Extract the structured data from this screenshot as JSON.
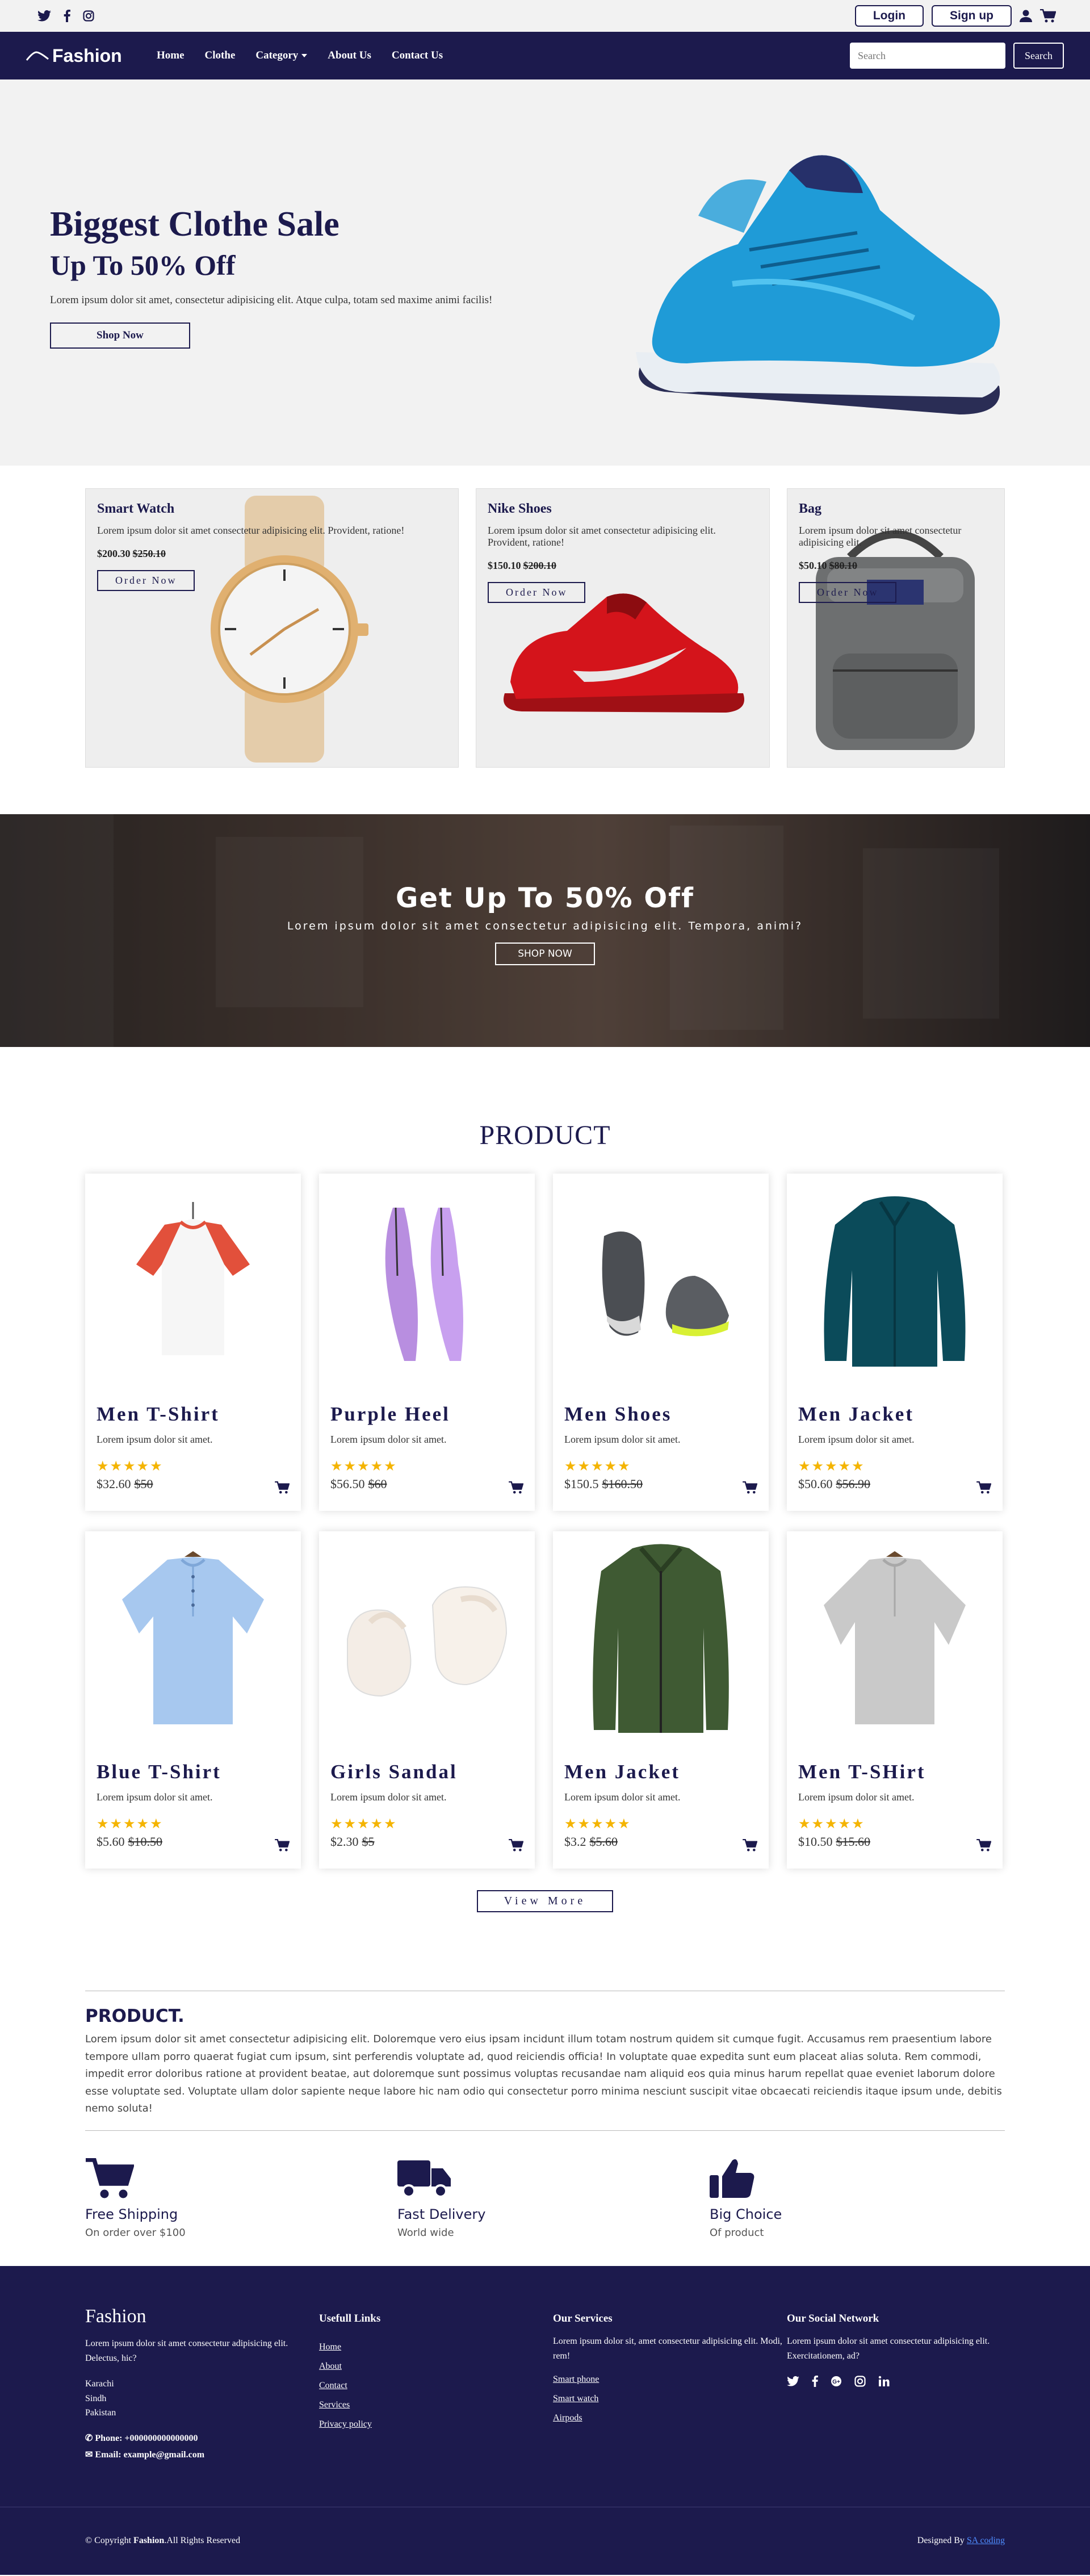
{
  "topbar": {
    "login": "Login",
    "signup": "Sign up"
  },
  "navbar": {
    "brand": "Fashion",
    "links": [
      "Home",
      "Clothe",
      "Category",
      "About Us",
      "Contact Us"
    ],
    "search_placeholder": "Search",
    "search_button": "Search"
  },
  "hero": {
    "title": "Biggest Clothe Sale",
    "subtitle": "Up To 50% Off",
    "text": "Lorem ipsum dolor sit amet, consectetur adipisicing elit. Atque culpa, totam sed maxime animi facilis!",
    "button": "Shop Now"
  },
  "offers": [
    {
      "title": "Smart Watch",
      "text": "Lorem ipsum dolor sit amet consectetur adipisicing elit. Provident, ratione!",
      "price": "$200.30",
      "old": "$250.10",
      "button": "Order Now"
    },
    {
      "title": "Nike Shoes",
      "text": "Lorem ipsum dolor sit amet consectetur adipisicing elit. Provident, ratione!",
      "price": "$150.10",
      "old": "$200.10",
      "button": "Order Now"
    },
    {
      "title": "Bag",
      "text": "Lorem ipsum dolor sit amet consectetur adipisicing elit.",
      "price": "$50.10",
      "old": "$80.10",
      "button": "Order Now"
    }
  ],
  "promo": {
    "title": "Get Up To 50% Off",
    "text": "Lorem ipsum dolor sit amet consectetur adipisicing elit. Tempora, animi?",
    "button": "SHOP NOW"
  },
  "products": {
    "title": "PRODUCT",
    "items": [
      {
        "name": "Men T-Shirt",
        "desc": "Lorem ipsum dolor sit amet.",
        "price": "$32.60",
        "old": "$50"
      },
      {
        "name": "Purple Heel",
        "desc": "Lorem ipsum dolor sit amet.",
        "price": "$56.50",
        "old": "$60"
      },
      {
        "name": "Men Shoes",
        "desc": "Lorem ipsum dolor sit amet.",
        "price": "$150.5",
        "old": "$160.50"
      },
      {
        "name": "Men Jacket",
        "desc": "Lorem ipsum dolor sit amet.",
        "price": "$50.60",
        "old": "$56.90"
      },
      {
        "name": "Blue T-Shirt",
        "desc": "Lorem ipsum dolor sit amet.",
        "price": "$5.60",
        "old": "$10.50"
      },
      {
        "name": "Girls Sandal",
        "desc": "Lorem ipsum dolor sit amet.",
        "price": "$2.30",
        "old": "$5"
      },
      {
        "name": "Men Jacket",
        "desc": "Lorem ipsum dolor sit amet.",
        "price": "$3.2",
        "old": "$5.60"
      },
      {
        "name": "Men T-SHirt",
        "desc": "Lorem ipsum dolor sit amet.",
        "price": "$10.50",
        "old": "$15.60"
      }
    ],
    "stars": "★★★★★",
    "view_more": "View More"
  },
  "about": {
    "title": "PRODUCT.",
    "text": "Lorem ipsum dolor sit amet consectetur adipisicing elit. Doloremque vero eius ipsam incidunt illum totam nostrum quidem sit cumque fugit. Accusamus rem praesentium labore tempore ullam porro quaerat fugiat cum ipsum, sint perferendis voluptate ad, quod reiciendis officia! In voluptate quae expedita sunt eum placeat alias soluta. Rem commodi, impedit error doloribus ratione at provident beatae, aut doloremque sunt possimus voluptas recusandae nam aliquid eos quia minus harum repellat quae eveniet laborum dolore esse voluptate sed. Voluptate ullam dolor sapiente neque labore hic nam odio qui consectetur porro minima nesciunt suscipit vitae obcaecati reiciendis itaque ipsum unde, debitis nemo soluta!"
  },
  "features": [
    {
      "title": "Free Shipping",
      "text": "On order over $100",
      "icon": "cart-icon"
    },
    {
      "title": "Fast Delivery",
      "text": "World wide",
      "icon": "truck-icon"
    },
    {
      "title": "Big Choice",
      "text": "Of product",
      "icon": "thumbs-up-icon"
    }
  ],
  "footer": {
    "logo": "Fashion",
    "about": "Lorem ipsum dolor sit amet consectetur adipisicing elit. Delectus, hic?",
    "address": [
      "Karachi",
      "Sindh",
      "Pakistan"
    ],
    "phone": "Phone: +000000000000000",
    "email": "Email: example@gmail.com",
    "links_title": "Usefull Links",
    "links": [
      "Home",
      "About",
      "Contact",
      "Services",
      "Privacy policy"
    ],
    "services_title": "Our Services",
    "services_text": "Lorem ipsum dolor sit, amet consectetur adipisicing elit. Modi, rem!",
    "services": [
      "Smart phone",
      "Smart watch",
      "Airpods"
    ],
    "social_title": "Our Social Network",
    "social_text": "Lorem ipsum dolor sit amet consectetur adipisicing elit. Exercitationem, ad?",
    "copyright_prefix": "© Copyright ",
    "copyright_brand": "Fashion",
    "copyright_suffix": ".All Rights Reserved",
    "designed_by": "Designed By ",
    "designer": "SA coding"
  },
  "colors": {
    "brand": "#1c1a4d",
    "star": "#f4b400",
    "link": "#4f8dff"
  }
}
